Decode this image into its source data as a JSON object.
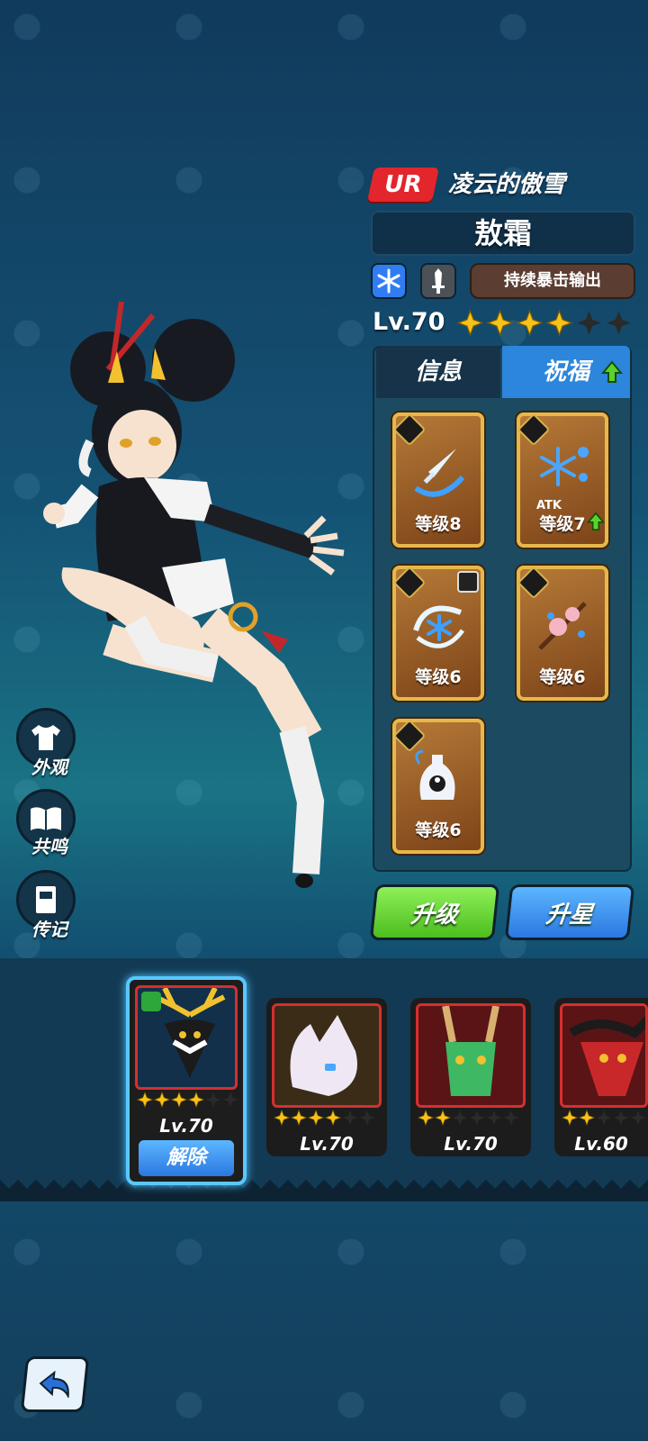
{
  "header": {
    "rarity": "UR",
    "title": "凌云的傲雪",
    "name": "敖霜",
    "role": "持续暴击输出",
    "level": "Lv.70",
    "stars_filled": 4,
    "stars_total": 6
  },
  "tabs": [
    {
      "label": "信息",
      "active": false
    },
    {
      "label": "祝福",
      "active": true,
      "has_upgrade": true
    }
  ],
  "blessings": [
    {
      "icon": "ice-sword-icon",
      "level": "等级8"
    },
    {
      "icon": "snowflake-atk-icon",
      "level": "等级7",
      "overlay": "ATK",
      "upgrade": true
    },
    {
      "icon": "frost-swirl-icon",
      "level": "等级6"
    },
    {
      "icon": "plum-blossom-icon",
      "level": "等级6"
    },
    {
      "icon": "yin-yang-vase-icon",
      "level": "等级6"
    }
  ],
  "actions": {
    "upgrade": "升级",
    "star_up": "升星"
  },
  "side_menu": [
    {
      "label": "外观",
      "icon": "shirt-icon"
    },
    {
      "label": "共鸣",
      "icon": "book-icon"
    },
    {
      "label": "传记",
      "icon": "journal-icon"
    }
  ],
  "pets": [
    {
      "level": "Lv.70",
      "stars": 4,
      "selected": true,
      "button": "解除",
      "icon": "antler-deer-icon"
    },
    {
      "level": "Lv.70",
      "stars": 4,
      "selected": false,
      "icon": "white-fox-icon"
    },
    {
      "level": "Lv.70",
      "stars": 2,
      "selected": false,
      "icon": "green-dragon-icon"
    },
    {
      "level": "Lv.60",
      "stars": 2,
      "selected": false,
      "icon": "red-demon-icon"
    }
  ],
  "colors": {
    "star": "#f7c21a",
    "rarity": "#e2262c",
    "accent_blue": "#2c86db",
    "accent_green": "#5bd22b"
  }
}
